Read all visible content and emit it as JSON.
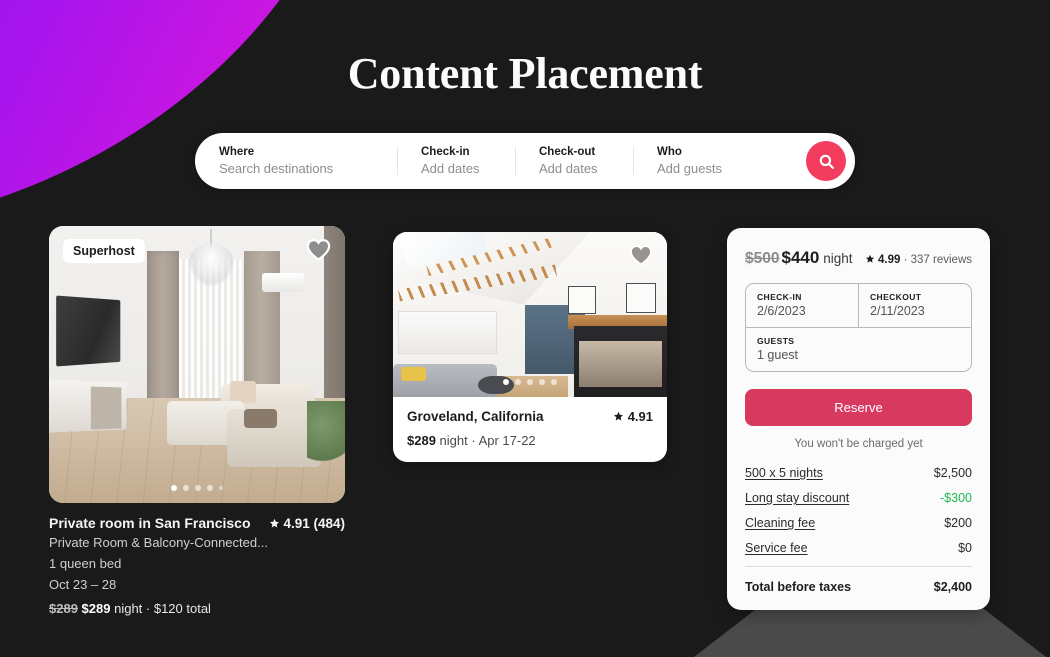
{
  "page": {
    "title": "Content Placement",
    "background_color": "#1a1a1a",
    "accent_gradient_from": "#7a13f5",
    "accent_gradient_to": "#e31fd2"
  },
  "search": {
    "fields": [
      {
        "label": "Where",
        "placeholder": "Search destinations"
      },
      {
        "label": "Check-in",
        "placeholder": "Add dates"
      },
      {
        "label": "Check-out",
        "placeholder": "Add dates"
      },
      {
        "label": "Who",
        "placeholder": "Add guests"
      }
    ],
    "button_icon": "search-icon",
    "button_color": "#f43c5e"
  },
  "listing_card": {
    "badge": "Superhost",
    "favorite_icon": "heart-icon",
    "title": "Private room in San Francisco",
    "rating": "4.91 (484)",
    "rating_icon": "star-icon",
    "subtitle": "Private Room & Balcony-Connected...",
    "beds": "1 queen bed",
    "dates": "Oct 23 – 28",
    "price_old": "$289",
    "price_new": "$289",
    "price_unit": "night · $120 total",
    "carousel_dots": 5,
    "carousel_active": 0
  },
  "photo_card": {
    "favorite_icon": "heart-icon",
    "location": "Groveland, California",
    "rating": "4.91",
    "rating_icon": "star-icon",
    "price": "$289",
    "price_meta": "night · Apr 17-22",
    "carousel_dots": 5,
    "carousel_active": 0
  },
  "booking_card": {
    "price_old": "$500",
    "price_new": "$440",
    "price_unit": "night",
    "rating_icon": "star-icon",
    "rating": "4.99",
    "reviews": "· 337 reviews",
    "dates": {
      "checkin_label": "CHECK-IN",
      "checkin_value": "2/6/2023",
      "checkout_label": "CHECKOUT",
      "checkout_value": "2/11/2023",
      "guests_label": "GUESTS",
      "guests_value": "1 guest"
    },
    "reserve_label": "Reserve",
    "reserve_color": "#d83a5f",
    "charge_note": "You won't be charged yet",
    "fees": [
      {
        "label": "500 x 5 nights",
        "value": "$2,500",
        "positive": false
      },
      {
        "label": "Long stay discount",
        "value": "-$300",
        "positive": true
      },
      {
        "label": "Cleaning fee",
        "value": "$200",
        "positive": false
      },
      {
        "label": "Service fee",
        "value": "$0",
        "positive": false
      }
    ],
    "discount_color": "#1ab94e",
    "total_label": "Total before taxes",
    "total_value": "$2,400"
  }
}
